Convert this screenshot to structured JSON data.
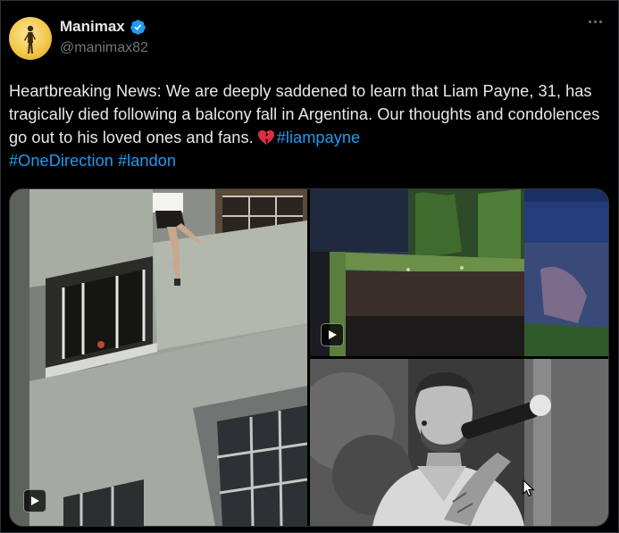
{
  "author": {
    "name": "Manimax",
    "handle": "@manimax82",
    "verified": true,
    "avatar_icon": "avatar-figure-icon"
  },
  "tweet": {
    "text_before": "Heartbreaking News: We are deeply saddened to learn that Liam Payne, 31, has tragically died following a balcony fall in Argentina. Our thoughts and condolences go out to his loved ones and fans.",
    "emoji_icon": "broken-heart-icon",
    "hashtags": [
      "#liampayne",
      "#OneDirection",
      "#landon"
    ]
  },
  "media": [
    {
      "name": "building-fall-video",
      "type": "video"
    },
    {
      "name": "balcony-garden-video",
      "type": "video"
    },
    {
      "name": "singer-microphone-photo",
      "type": "photo"
    }
  ],
  "colors": {
    "background": "#000000",
    "text": "#e7e9ea",
    "muted": "#71767b",
    "link": "#1d9bf0",
    "verified": "#1d9bf0",
    "border": "#2f3336"
  }
}
